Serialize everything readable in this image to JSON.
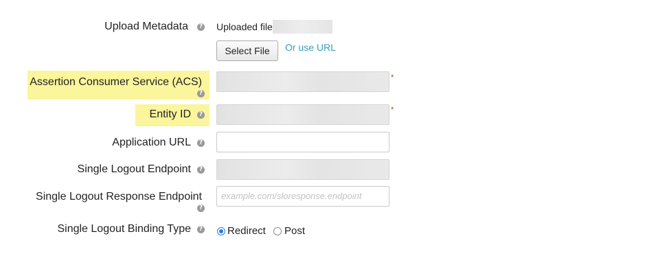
{
  "form": {
    "upload_metadata": {
      "label": "Upload Metadata",
      "status_text": "Uploaded file",
      "select_file_button": "Select File",
      "or_use_url_link": "Or use URL"
    },
    "acs": {
      "label": "Assertion Consumer Service (ACS)",
      "required_marker": "*",
      "value": ""
    },
    "entity_id": {
      "label": "Entity ID",
      "required_marker": "*",
      "value": ""
    },
    "application_url": {
      "label": "Application URL",
      "value": ""
    },
    "single_logout_endpoint": {
      "label": "Single Logout Endpoint",
      "value": ""
    },
    "single_logout_response_endpoint": {
      "label": "Single Logout Response Endpoint",
      "placeholder": "example.com/sloresponse.endpoint"
    },
    "single_logout_binding_type": {
      "label": "Single Logout Binding Type",
      "options": [
        "Redirect",
        "Post"
      ],
      "selected": "Redirect"
    },
    "help_icon_glyph": "?"
  },
  "colors": {
    "highlight": "#fbf59b",
    "link": "#2f9ec4",
    "required": "#c0392b",
    "radio_selected": "#2a7ae2"
  },
  "icons": [
    "help-icon"
  ]
}
